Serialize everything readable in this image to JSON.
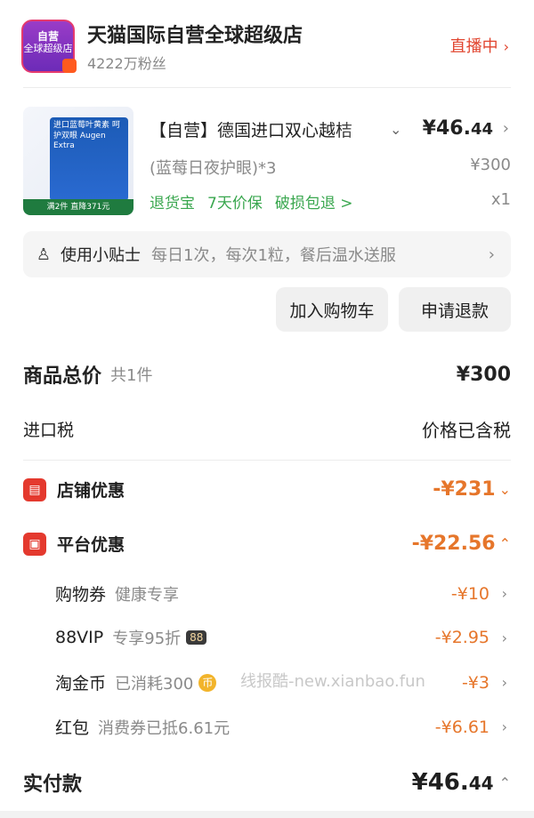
{
  "store": {
    "logo_line1": "自营",
    "logo_line2": "全球超级店",
    "name": "天猫国际自营全球超级店",
    "fans": "4222万粉丝",
    "live_label": "直播中"
  },
  "product": {
    "image_caption": "满2件 直降371元",
    "image_text": "进口蓝莓叶黄素 呵护双眼 Augen Extra",
    "title": "【自营】德国进口双心越桔",
    "price_symbol": "¥",
    "price_int": "46.",
    "price_dec": "44",
    "spec": "(蓝莓日夜护眼)*3",
    "original_price": "¥300",
    "services": [
      "退货宝",
      "7天价保",
      "破损包退 >"
    ],
    "quantity": "x1"
  },
  "tips": {
    "label": "使用小贴士",
    "value": "每日1次，每次1粒，餐后温水送服"
  },
  "buttons": {
    "add_cart": "加入购物车",
    "refund": "申请退款"
  },
  "summary": {
    "total_label": "商品总价",
    "total_count": "共1件",
    "total_value": "¥300",
    "tax_label": "进口税",
    "tax_value": "价格已含税",
    "shop_discount_label": "店铺优惠",
    "shop_discount_value": "-¥231",
    "platform_discount_label": "平台优惠",
    "platform_discount_value": "-¥22.56",
    "items": [
      {
        "label": "购物券",
        "tag": "健康专享",
        "value": "-¥10"
      },
      {
        "label": "88VIP",
        "tag": "专享95折",
        "badge": "88",
        "value": "-¥2.95"
      },
      {
        "label": "淘金币",
        "tag": "已消耗300",
        "coin": "币",
        "value": "-¥3"
      },
      {
        "label": "红包",
        "tag": "消费券已抵6.61元",
        "value": "-¥6.61"
      }
    ],
    "paid_label": "实付款",
    "paid_symbol": "¥",
    "paid_int": "46.",
    "paid_dec": "44"
  },
  "watermark": "线报酷-new.xianbao.fun",
  "colors": {
    "accent_red": "#e1452f",
    "discount_orange": "#e6762b",
    "service_green": "#3aa74f"
  }
}
